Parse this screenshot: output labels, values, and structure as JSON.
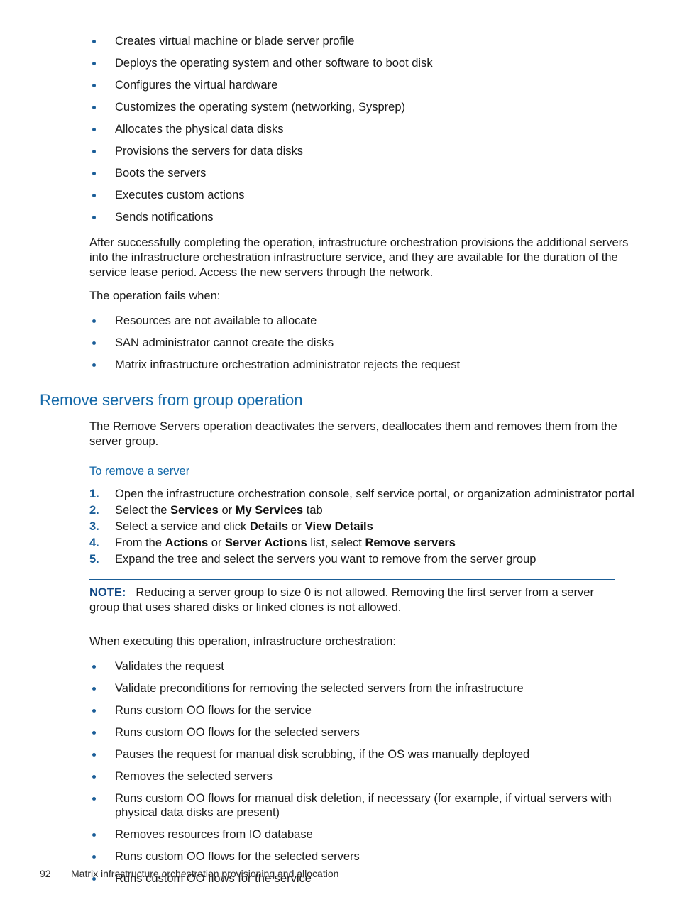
{
  "colors": {
    "heading_blue": "#1368a8",
    "marker_blue": "#1a5d97",
    "note_label_blue": "#134a86",
    "rule_blue": "#1a5d97",
    "body_text": "#1a1a1a"
  },
  "operation_steps_list": [
    "Creates virtual machine or blade server profile",
    "Deploys the operating system and other software to boot disk",
    "Configures the virtual hardware",
    "Customizes the operating system (networking, Sysprep)",
    "Allocates the physical data disks",
    "Provisions the servers for data disks",
    "Boots the servers",
    "Executes custom actions",
    "Sends notifications"
  ],
  "success_paragraph": "After successfully completing the operation, infrastructure orchestration provisions the additional servers into the infrastructure orchestration infrastructure service, and they are available for the duration of the service lease period. Access the new servers through the network.",
  "fails_intro": "The operation fails when:",
  "failure_list": [
    "Resources are not available to allocate",
    "SAN administrator cannot create the disks",
    "Matrix infrastructure orchestration administrator rejects the request"
  ],
  "section": {
    "heading": "Remove servers from group operation",
    "intro_paragraph": "The Remove Servers operation deactivates the servers, deallocates them and removes them from the server group.",
    "subheading": "To remove a server",
    "steps": [
      {
        "number": "1.",
        "parts": [
          {
            "text": "Open the infrastructure orchestration console, self service portal, or organization administrator portal",
            "bold": false
          }
        ]
      },
      {
        "number": "2.",
        "parts": [
          {
            "text": "Select the ",
            "bold": false
          },
          {
            "text": "Services",
            "bold": true
          },
          {
            "text": " or ",
            "bold": false
          },
          {
            "text": "My Services",
            "bold": true
          },
          {
            "text": " tab",
            "bold": false
          }
        ]
      },
      {
        "number": "3.",
        "parts": [
          {
            "text": "Select a service and click ",
            "bold": false
          },
          {
            "text": "Details",
            "bold": true
          },
          {
            "text": " or ",
            "bold": false
          },
          {
            "text": "View Details",
            "bold": true
          }
        ]
      },
      {
        "number": "4.",
        "parts": [
          {
            "text": "From the ",
            "bold": false
          },
          {
            "text": "Actions",
            "bold": true
          },
          {
            "text": " or ",
            "bold": false
          },
          {
            "text": "Server Actions",
            "bold": true
          },
          {
            "text": " list, select ",
            "bold": false
          },
          {
            "text": "Remove servers",
            "bold": true
          }
        ]
      },
      {
        "number": "5.",
        "parts": [
          {
            "text": "Expand the tree and select the servers you want to remove from the server group",
            "bold": false
          }
        ]
      }
    ]
  },
  "note": {
    "label": "NOTE:",
    "text": "Reducing a server group to size 0 is not allowed. Removing the first server from a server group that uses shared disks or linked clones is not allowed."
  },
  "executing_intro": "When executing this operation, infrastructure orchestration:",
  "executing_list": [
    "Validates the request",
    "Validate preconditions for removing the selected servers from the infrastructure",
    "Runs custom OO flows for the service",
    "Runs custom OO flows for the selected servers",
    "Pauses the request for manual disk scrubbing, if the OS was manually deployed",
    "Removes the selected servers",
    "Runs custom OO flows for manual disk deletion, if necessary (for example, if virtual servers with physical data disks are present)",
    "Removes resources from IO database",
    "Runs custom OO flows for the selected servers",
    "Runs custom OO flows for the service"
  ],
  "footer": {
    "page_number": "92",
    "title": "Matrix infrastructure orchestration provisioning and allocation"
  }
}
